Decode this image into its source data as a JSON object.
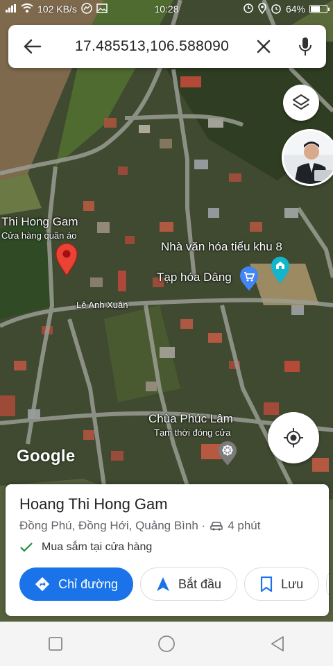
{
  "status_bar": {
    "network_speed": "102 KB/s",
    "time": "10:28",
    "battery_percent": "64%",
    "battery_level": 0.64
  },
  "search": {
    "query": "17.485513,106.588090"
  },
  "map": {
    "pin_place": {
      "name": "Thi Hong Gam",
      "category": "Cửa hàng quần áo"
    },
    "labels": [
      {
        "text": "Nhà văn hóa tiểu khu 8"
      },
      {
        "text": "Tạp hóa Dâng"
      },
      {
        "text": "Lê Anh Xuân"
      },
      {
        "text": "Chùa Phúc Lâm"
      },
      {
        "text": "Tạm thời đóng cửa"
      }
    ],
    "attribution": "Google"
  },
  "place_card": {
    "name": "Hoang Thi Hong Gam",
    "address": "Đồng Phú, Đồng Hới, Quảng Bình ·",
    "drive_time": "4 phút",
    "feature": "Mua sắm tại cửa hàng"
  },
  "actions": {
    "directions": "Chỉ đường",
    "start": "Bắt đầu",
    "save": "Lưu"
  },
  "colors": {
    "accent": "#1a73e8",
    "pin": "#ea4335",
    "check": "#1e8e3e",
    "shopping_pin": "#4285f4",
    "landmark_pin": "#12b5cb",
    "temple_pin": "#7b7b7b"
  }
}
